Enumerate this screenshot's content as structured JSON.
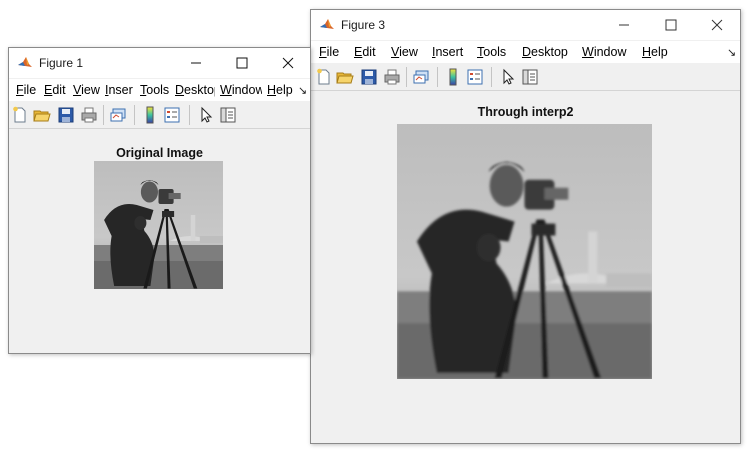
{
  "figure1": {
    "title": "Figure 1",
    "menus": [
      {
        "pre": "",
        "u": "F",
        "post": "ile"
      },
      {
        "pre": "",
        "u": "E",
        "post": "dit"
      },
      {
        "pre": "",
        "u": "V",
        "post": "iew"
      },
      {
        "pre": "",
        "u": "I",
        "post": "nsert"
      },
      {
        "pre": "",
        "u": "T",
        "post": "ools"
      },
      {
        "pre": "",
        "u": "D",
        "post": "esktop"
      },
      {
        "pre": "",
        "u": "W",
        "post": "indow"
      },
      {
        "pre": "",
        "u": "H",
        "post": "elp"
      }
    ],
    "overflow_glyph": "↘",
    "axes_title": "Original Image"
  },
  "figure3": {
    "title": "Figure 3",
    "menus": [
      {
        "pre": "",
        "u": "F",
        "post": "ile"
      },
      {
        "pre": "",
        "u": "E",
        "post": "dit"
      },
      {
        "pre": "",
        "u": "V",
        "post": "iew"
      },
      {
        "pre": "",
        "u": "I",
        "post": "nsert"
      },
      {
        "pre": "",
        "u": "T",
        "post": "ools"
      },
      {
        "pre": "",
        "u": "D",
        "post": "esktop"
      },
      {
        "pre": "",
        "u": "W",
        "post": "indow"
      },
      {
        "pre": "",
        "u": "H",
        "post": "elp"
      }
    ],
    "overflow_glyph": "↘",
    "axes_title": "Through interp2"
  },
  "toolbar_icons": [
    "new-figure-icon",
    "open-file-icon",
    "save-icon",
    "print-icon",
    "link-plot-icon",
    "colorbar-icon",
    "legend-icon",
    "pointer-icon",
    "property-inspector-icon"
  ],
  "window_controls": [
    "minimize-icon",
    "maximize-icon",
    "close-icon"
  ]
}
